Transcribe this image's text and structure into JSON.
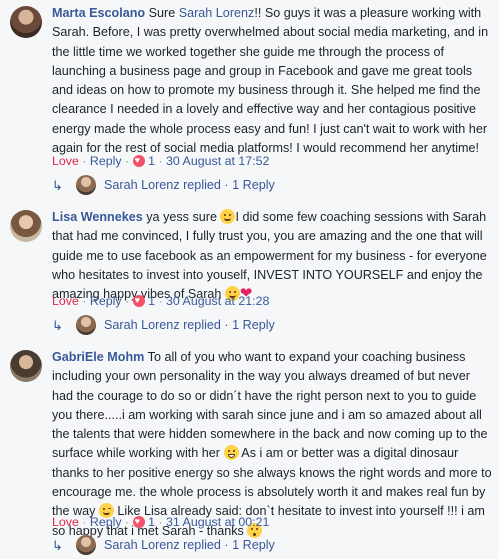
{
  "comments": [
    {
      "author": "Marta Escolano",
      "text_before": " Sure ",
      "mention": "Sarah Lorenz",
      "text_after": "!! So guys it was a pleasure working with Sarah. Before, I was pretty overwhelmed about social media marketing, and in the little time we worked together she guide me through the process of launching a business page and group in Facebook and gave me great tools and ideas on how to promote my business through it. She helped me find the clearance I needed in a lovely and effective way and her contagious positive energy made the whole process easy and fun! I just can't wait to work with her again for the rest of social media platforms! I would recommend her anytime!",
      "actions": {
        "love": "Love",
        "reply": "Reply",
        "likes": "1",
        "timestamp": "30 August at 17:52"
      },
      "reply_summary": {
        "replier": "Sarah Lorenz replied",
        "count": "1 Reply"
      }
    },
    {
      "author": "Lisa Wennekes",
      "text_a": " ya yess sure ",
      "text_b": "I did some few coaching sessions with Sarah that had me convinced, I fully trust you, you are amazing and the one that will guide me to use facebook as an empowerment for my business - for everyone who hesitates to invest into youself, INVEST INTO YOURSELF and enjoy the amazing happy vibes of Sarah ",
      "emoji_a": "smiling-face-emoji",
      "emoji_b": "smiling-face-emoji",
      "emoji_c": "heart-emoji",
      "actions": {
        "love": "Love",
        "reply": "Reply",
        "likes": "1",
        "timestamp": "30 August at 21:28"
      },
      "reply_summary": {
        "replier": "Sarah Lorenz replied",
        "count": "1 Reply"
      }
    },
    {
      "author": "GabriEle Mohm",
      "text_a": " To all of you who want to expand your coaching business including your own personality in the way you always dreamed of but never had the courage to do so or didn´t have the right person next to you to guide you there.....i am working with sarah since june and i am so amazed about all the talents that were hidden somewhere in the back and now coming up to the surface while working with her ",
      "text_b": " As i am or better was a digital dinosaur thanks to her positive energy so she always knows the right words and more to encourage me. the whole process is absolutely worth it and makes real fun by the way ",
      "text_c": " Like Lisa already said: don`t hesitate to invest into yourself !!! i am so happy that i met Sarah - thanks ",
      "emoji_a": "grinning-face-emoji",
      "emoji_b": "winking-face-emoji",
      "emoji_c": "kissing-face-emoji",
      "actions": {
        "love": "Love",
        "reply": "Reply",
        "likes": "1",
        "timestamp": "31 August at 00:21"
      },
      "reply_summary": {
        "replier": "Sarah Lorenz replied",
        "count": "1 Reply"
      }
    }
  ],
  "colors": {
    "link": "#385898",
    "love": "#e2264d",
    "meta": "#90949c",
    "background": "#f6f7f9"
  },
  "icons": {
    "reply_arrow": "reply-arrow-icon",
    "like_badge": "heart-like-icon"
  }
}
